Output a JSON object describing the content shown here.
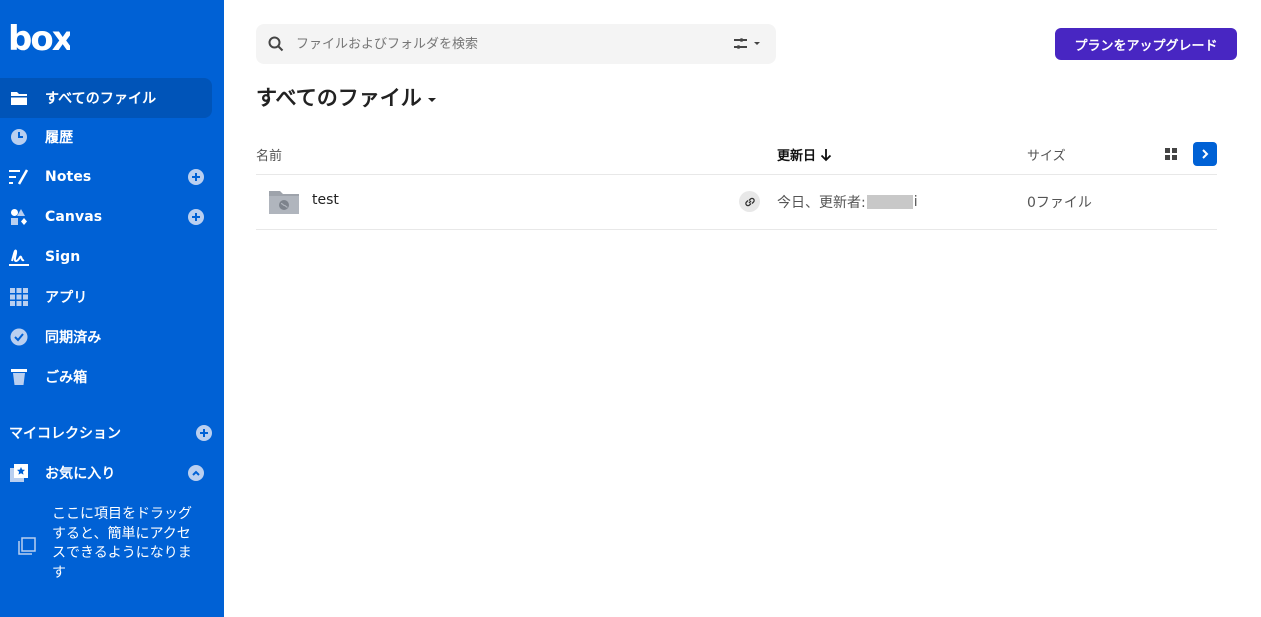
{
  "brand": {
    "logo_text": "box",
    "sidebar_color": "#0061d5",
    "accent": "#4826c2"
  },
  "sidebar": {
    "items": [
      {
        "label": "すべてのファイル",
        "icon": "folder-icon",
        "active": true
      },
      {
        "label": "履歴",
        "icon": "clock-icon"
      },
      {
        "label": "Notes",
        "icon": "notes-icon",
        "has_add": true
      },
      {
        "label": "Canvas",
        "icon": "canvas-icon",
        "has_add": true
      },
      {
        "label": "Sign",
        "icon": "signature-icon"
      },
      {
        "label": "アプリ",
        "icon": "apps-grid-icon"
      },
      {
        "label": "同期済み",
        "icon": "check-circle-icon"
      },
      {
        "label": "ごみ箱",
        "icon": "trash-icon"
      }
    ],
    "collections_label": "マイコレクション",
    "favorites_label": "お気に入り",
    "favorites_hint": "ここに項目をドラッグすると、簡単にアクセスできるようになります"
  },
  "search": {
    "placeholder": "ファイルおよびフォルダを検索",
    "value": ""
  },
  "upgrade_label": "プランをアップグレード",
  "page_title": "すべてのファイル",
  "columns": {
    "name": "名前",
    "updated": "更新日",
    "size": "サイズ"
  },
  "rows": [
    {
      "name": "test",
      "updated_prefix": "今日、更新者:",
      "updated_suffix": "i",
      "size": "0ファイル"
    }
  ]
}
